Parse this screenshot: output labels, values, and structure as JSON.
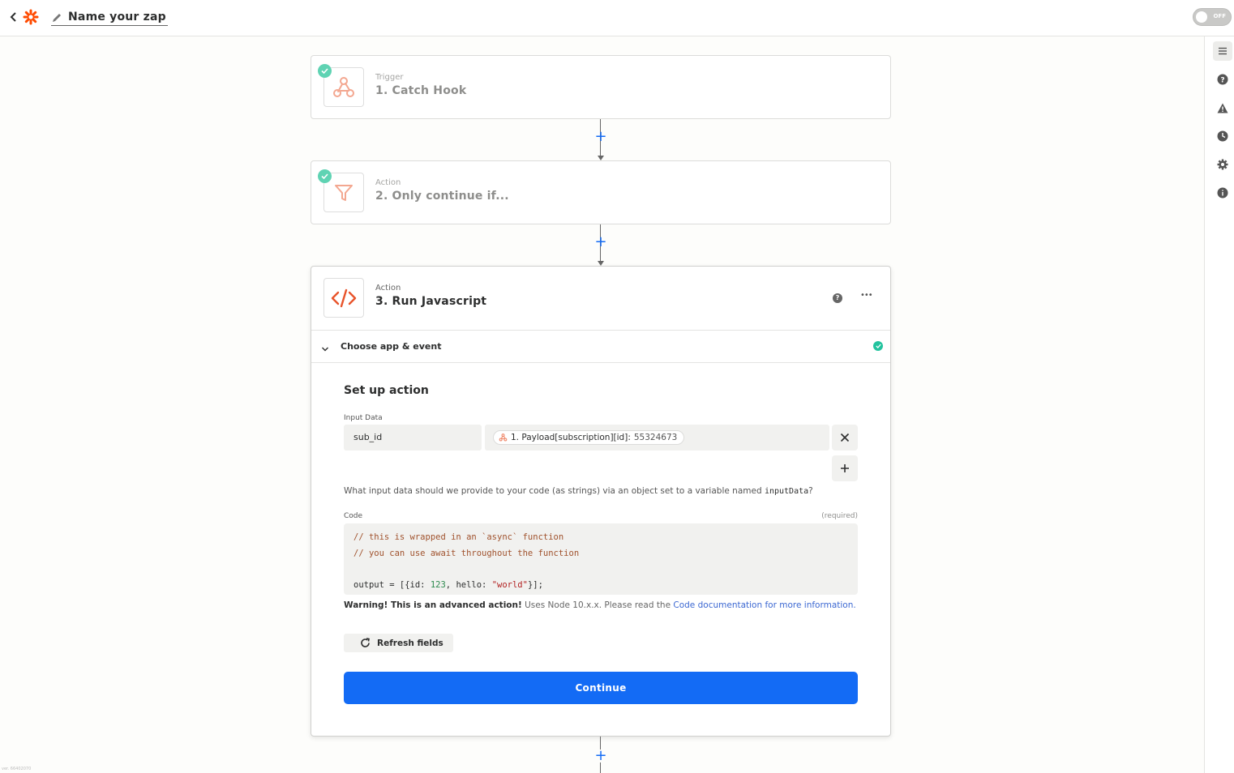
{
  "header": {
    "zap_name": "Name your zap",
    "toggle_label": "OFF"
  },
  "steps": [
    {
      "kind": "Trigger",
      "title": "1. Catch Hook",
      "icon": "webhook-icon"
    },
    {
      "kind": "Action",
      "title": "2. Only continue if...",
      "icon": "filter-icon"
    },
    {
      "kind": "Action",
      "title": "3. Run Javascript",
      "icon": "code-icon"
    }
  ],
  "active_step": {
    "section_label": "Choose app & event",
    "setup_title": "Set up action",
    "input_data_label": "Input Data",
    "input_key": "sub_id",
    "input_value_ref": "1. Payload[subscription][id]:",
    "input_value_sample": "55324673",
    "help_text_before": "What input data should we provide to your code (as strings) via an object set to a variable named ",
    "help_text_code": "inputData",
    "help_text_after": "?",
    "code_label": "Code",
    "code_required": "(required)",
    "code_lines": {
      "l1": "// this is wrapped in an `async` function",
      "l2": "// you can use await throughout the function",
      "l4_a": "output = [{id: ",
      "l4_num": "123",
      "l4_b": ", hello: ",
      "l4_str": "\"world\"",
      "l4_c": "}];"
    },
    "warning_bold": "Warning! This is an advanced action!",
    "warning_text": " Uses Node 10.x.x. Please read the ",
    "warning_link": "Code documentation for more information.",
    "refresh_label": "Refresh fields",
    "continue_label": "Continue"
  },
  "rail": [
    "outline-icon",
    "help-icon",
    "warning-icon",
    "history-icon",
    "settings-icon",
    "info-icon"
  ],
  "version_text": "ver. 66402070",
  "colors": {
    "brand": "#ff4a00",
    "primary": "#136bf5",
    "success": "#5fd3b3"
  }
}
